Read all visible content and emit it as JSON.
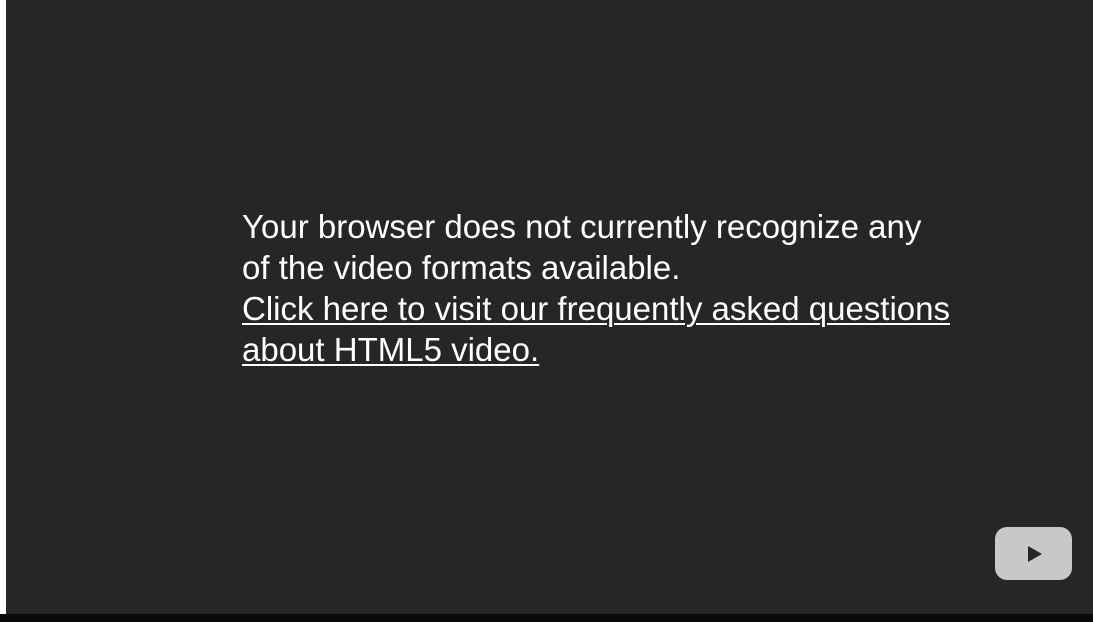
{
  "player": {
    "message_line_1": "Your browser does not currently recognize any",
    "message_line_2": "of the video formats available.",
    "faq_link_text": "Click here to visit our frequently asked questions about HTML5 video.",
    "youtube_button": {
      "icon": "play-icon",
      "bg_color": "#c8c8c8",
      "icon_color": "#262626"
    },
    "background_color": "#262626"
  }
}
